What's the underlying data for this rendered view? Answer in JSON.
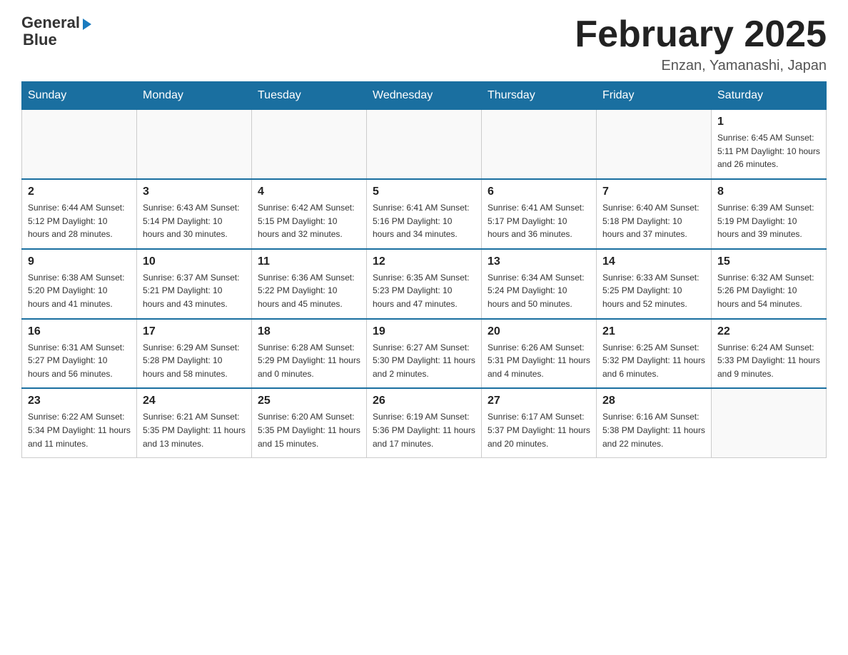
{
  "logo": {
    "line1": "General",
    "line2": "Blue"
  },
  "title": "February 2025",
  "location": "Enzan, Yamanashi, Japan",
  "days_of_week": [
    "Sunday",
    "Monday",
    "Tuesday",
    "Wednesday",
    "Thursday",
    "Friday",
    "Saturday"
  ],
  "weeks": [
    [
      {
        "day": "",
        "info": ""
      },
      {
        "day": "",
        "info": ""
      },
      {
        "day": "",
        "info": ""
      },
      {
        "day": "",
        "info": ""
      },
      {
        "day": "",
        "info": ""
      },
      {
        "day": "",
        "info": ""
      },
      {
        "day": "1",
        "info": "Sunrise: 6:45 AM\nSunset: 5:11 PM\nDaylight: 10 hours\nand 26 minutes."
      }
    ],
    [
      {
        "day": "2",
        "info": "Sunrise: 6:44 AM\nSunset: 5:12 PM\nDaylight: 10 hours\nand 28 minutes."
      },
      {
        "day": "3",
        "info": "Sunrise: 6:43 AM\nSunset: 5:14 PM\nDaylight: 10 hours\nand 30 minutes."
      },
      {
        "day": "4",
        "info": "Sunrise: 6:42 AM\nSunset: 5:15 PM\nDaylight: 10 hours\nand 32 minutes."
      },
      {
        "day": "5",
        "info": "Sunrise: 6:41 AM\nSunset: 5:16 PM\nDaylight: 10 hours\nand 34 minutes."
      },
      {
        "day": "6",
        "info": "Sunrise: 6:41 AM\nSunset: 5:17 PM\nDaylight: 10 hours\nand 36 minutes."
      },
      {
        "day": "7",
        "info": "Sunrise: 6:40 AM\nSunset: 5:18 PM\nDaylight: 10 hours\nand 37 minutes."
      },
      {
        "day": "8",
        "info": "Sunrise: 6:39 AM\nSunset: 5:19 PM\nDaylight: 10 hours\nand 39 minutes."
      }
    ],
    [
      {
        "day": "9",
        "info": "Sunrise: 6:38 AM\nSunset: 5:20 PM\nDaylight: 10 hours\nand 41 minutes."
      },
      {
        "day": "10",
        "info": "Sunrise: 6:37 AM\nSunset: 5:21 PM\nDaylight: 10 hours\nand 43 minutes."
      },
      {
        "day": "11",
        "info": "Sunrise: 6:36 AM\nSunset: 5:22 PM\nDaylight: 10 hours\nand 45 minutes."
      },
      {
        "day": "12",
        "info": "Sunrise: 6:35 AM\nSunset: 5:23 PM\nDaylight: 10 hours\nand 47 minutes."
      },
      {
        "day": "13",
        "info": "Sunrise: 6:34 AM\nSunset: 5:24 PM\nDaylight: 10 hours\nand 50 minutes."
      },
      {
        "day": "14",
        "info": "Sunrise: 6:33 AM\nSunset: 5:25 PM\nDaylight: 10 hours\nand 52 minutes."
      },
      {
        "day": "15",
        "info": "Sunrise: 6:32 AM\nSunset: 5:26 PM\nDaylight: 10 hours\nand 54 minutes."
      }
    ],
    [
      {
        "day": "16",
        "info": "Sunrise: 6:31 AM\nSunset: 5:27 PM\nDaylight: 10 hours\nand 56 minutes."
      },
      {
        "day": "17",
        "info": "Sunrise: 6:29 AM\nSunset: 5:28 PM\nDaylight: 10 hours\nand 58 minutes."
      },
      {
        "day": "18",
        "info": "Sunrise: 6:28 AM\nSunset: 5:29 PM\nDaylight: 11 hours\nand 0 minutes."
      },
      {
        "day": "19",
        "info": "Sunrise: 6:27 AM\nSunset: 5:30 PM\nDaylight: 11 hours\nand 2 minutes."
      },
      {
        "day": "20",
        "info": "Sunrise: 6:26 AM\nSunset: 5:31 PM\nDaylight: 11 hours\nand 4 minutes."
      },
      {
        "day": "21",
        "info": "Sunrise: 6:25 AM\nSunset: 5:32 PM\nDaylight: 11 hours\nand 6 minutes."
      },
      {
        "day": "22",
        "info": "Sunrise: 6:24 AM\nSunset: 5:33 PM\nDaylight: 11 hours\nand 9 minutes."
      }
    ],
    [
      {
        "day": "23",
        "info": "Sunrise: 6:22 AM\nSunset: 5:34 PM\nDaylight: 11 hours\nand 11 minutes."
      },
      {
        "day": "24",
        "info": "Sunrise: 6:21 AM\nSunset: 5:35 PM\nDaylight: 11 hours\nand 13 minutes."
      },
      {
        "day": "25",
        "info": "Sunrise: 6:20 AM\nSunset: 5:35 PM\nDaylight: 11 hours\nand 15 minutes."
      },
      {
        "day": "26",
        "info": "Sunrise: 6:19 AM\nSunset: 5:36 PM\nDaylight: 11 hours\nand 17 minutes."
      },
      {
        "day": "27",
        "info": "Sunrise: 6:17 AM\nSunset: 5:37 PM\nDaylight: 11 hours\nand 20 minutes."
      },
      {
        "day": "28",
        "info": "Sunrise: 6:16 AM\nSunset: 5:38 PM\nDaylight: 11 hours\nand 22 minutes."
      },
      {
        "day": "",
        "info": ""
      }
    ]
  ]
}
